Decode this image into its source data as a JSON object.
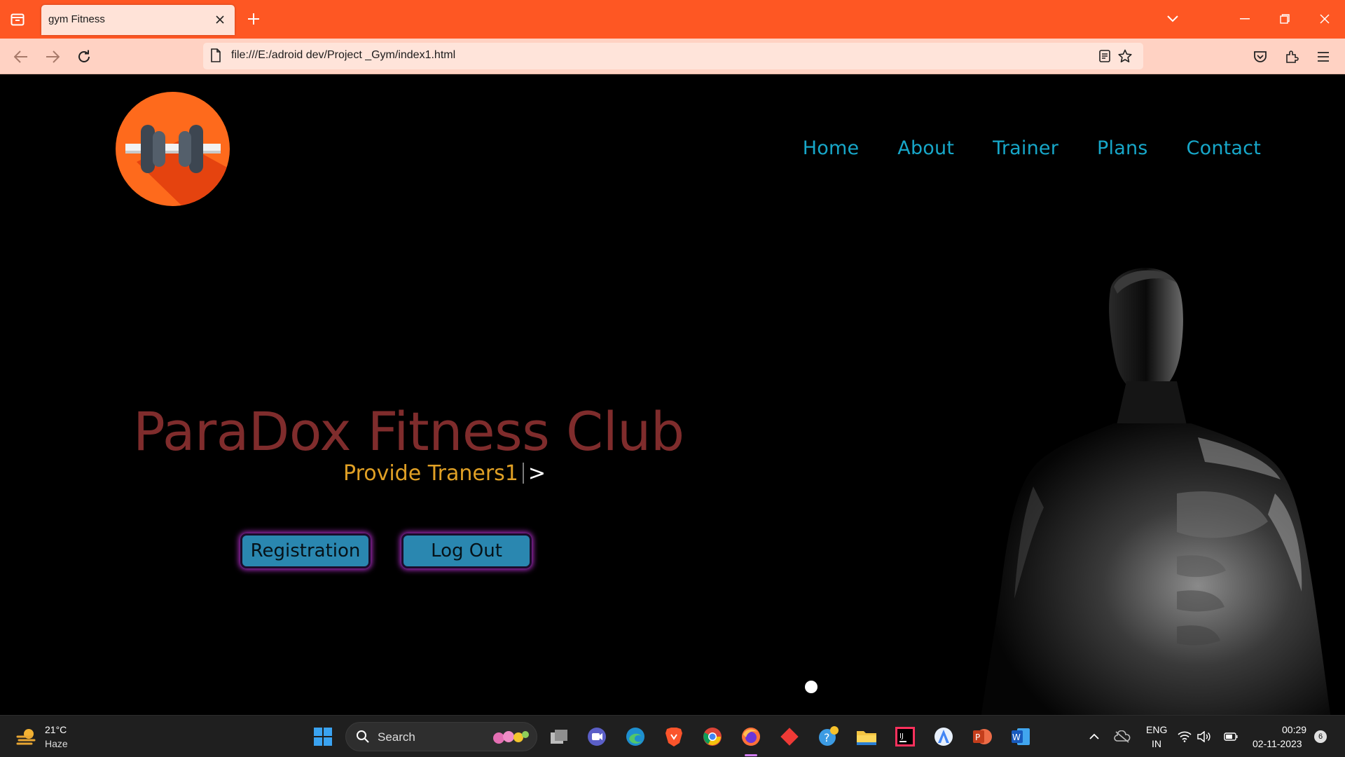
{
  "browser": {
    "tab_title": "gym Fitness",
    "url": "file:///E:/adroid dev/Project _Gym/index1.html"
  },
  "page": {
    "nav": [
      "Home",
      "About",
      "Trainer",
      "Plans",
      "Contact"
    ],
    "hero_title": "ParaDox Fitness Club",
    "hero_subtitle": "Provide Traners1",
    "hero_subtitle_arrow": ">",
    "buttons": {
      "registration": "Registration",
      "logout": "Log Out"
    },
    "colors": {
      "nav_link": "#17a7c9",
      "title": "#7f2c2c",
      "subtitle": "#e0a025",
      "button_bg": "#2a87b0",
      "button_glow": "#b12ec9"
    }
  },
  "taskbar": {
    "weather_temp": "21°C",
    "weather_desc": "Haze",
    "search_placeholder": "Search",
    "lang_top": "ENG",
    "lang_bottom": "IN",
    "time": "00:29",
    "date": "02-11-2023",
    "notification_count": "6"
  }
}
